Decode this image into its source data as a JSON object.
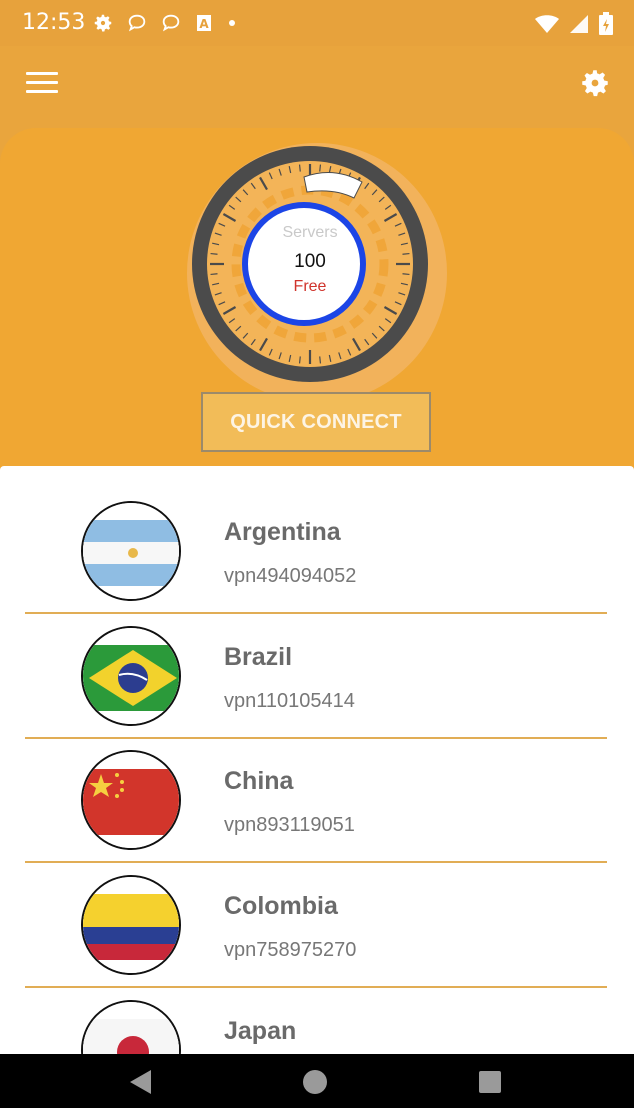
{
  "status_bar": {
    "time": "12:53",
    "left_icons": [
      "gear-icon",
      "chat-bubble-icon",
      "chat-bubble-icon",
      "a-box-icon",
      "dot-icon"
    ],
    "right_icons": [
      "wifi-icon",
      "signal-icon",
      "battery-icon"
    ]
  },
  "toolbar": {
    "menu_icon": "hamburger-menu-icon",
    "settings_icon": "gear-icon"
  },
  "dial": {
    "servers_label": "Servers",
    "server_count": "100",
    "plan_label": "Free"
  },
  "quick_connect_label": "QUICK CONNECT",
  "servers": [
    {
      "country": "Argentina",
      "server_id": "vpn494094052",
      "flag": "argentina-flag"
    },
    {
      "country": "Brazil",
      "server_id": "vpn110105414",
      "flag": "brazil-flag"
    },
    {
      "country": "China",
      "server_id": "vpn893119051",
      "flag": "china-flag"
    },
    {
      "country": "Colombia",
      "server_id": "vpn758975270",
      "flag": "colombia-flag"
    },
    {
      "country": "Japan",
      "server_id": "",
      "flag": "japan-flag"
    }
  ],
  "nav_bar": {
    "back_icon": "back-triangle-icon",
    "home_icon": "home-circle-icon",
    "recents_icon": "recents-square-icon"
  },
  "colors": {
    "header_orange": "#e9a53d",
    "hero_orange": "#f0a733",
    "ring_blue": "#1c45e6",
    "free_red": "#d0342c",
    "divider": "#e1ad55"
  }
}
